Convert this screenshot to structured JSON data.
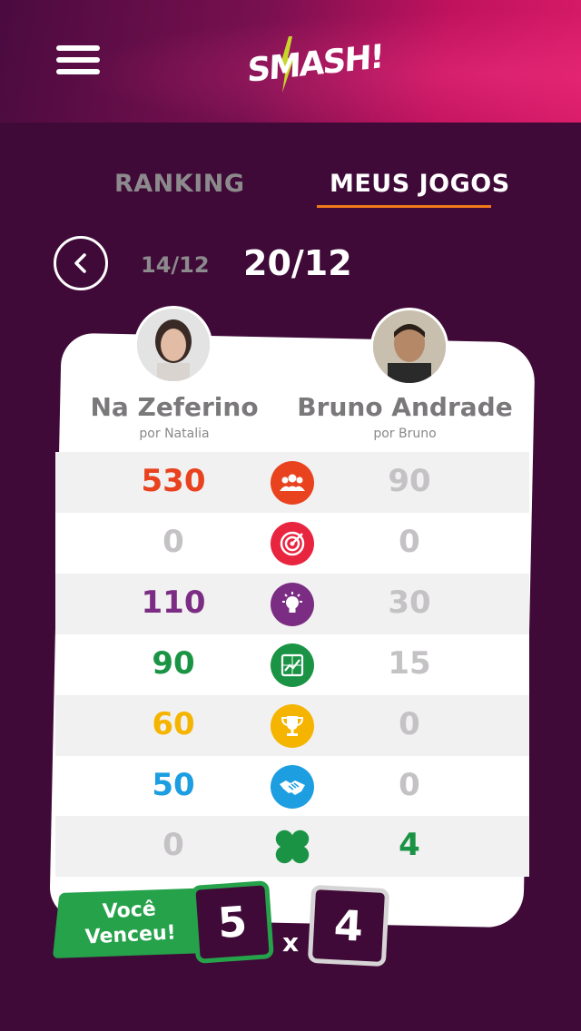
{
  "header": {
    "menu_icon": "hamburger-menu-icon",
    "logo_text": "SMASH!"
  },
  "tabs": [
    {
      "label": "RANKING",
      "active": false
    },
    {
      "label": "MEUS JOGOS",
      "active": true
    }
  ],
  "date_nav": {
    "previous": "14/12",
    "current": "20/12"
  },
  "players": [
    {
      "name": "Na Zeferino",
      "sub": "por Natalia"
    },
    {
      "name": "Bruno Andrade",
      "sub": "por Bruno"
    }
  ],
  "stats": [
    {
      "icon": "people-icon",
      "color": "#e8421e",
      "left": "530",
      "right": "90",
      "left_color": "#e8421e",
      "right_color": "#c4c2c4"
    },
    {
      "icon": "target-icon",
      "color": "#e8243f",
      "left": "0",
      "right": "0",
      "left_color": "#c4c2c4",
      "right_color": "#c4c2c4"
    },
    {
      "icon": "lightbulb-icon",
      "color": "#7b2d83",
      "left": "110",
      "right": "30",
      "left_color": "#7b2d83",
      "right_color": "#c4c2c4"
    },
    {
      "icon": "chart-icon",
      "color": "#1a9444",
      "left": "90",
      "right": "15",
      "left_color": "#1a9444",
      "right_color": "#c4c2c4"
    },
    {
      "icon": "trophy-icon",
      "color": "#f5b400",
      "left": "60",
      "right": "0",
      "left_color": "#f5b400",
      "right_color": "#c4c2c4"
    },
    {
      "icon": "handshake-icon",
      "color": "#1d9ee0",
      "left": "50",
      "right": "0",
      "left_color": "#1d9ee0",
      "right_color": "#c4c2c4"
    },
    {
      "icon": "clover-icon",
      "color": "#1a9444",
      "left": "0",
      "right": "4",
      "left_color": "#c4c2c4",
      "right_color": "#1a9444"
    }
  ],
  "result": {
    "banner": "Você Venceu!",
    "banner_line1": "Você",
    "banner_line2": "Venceu!",
    "score_left": "5",
    "separator": "x",
    "score_right": "4"
  }
}
